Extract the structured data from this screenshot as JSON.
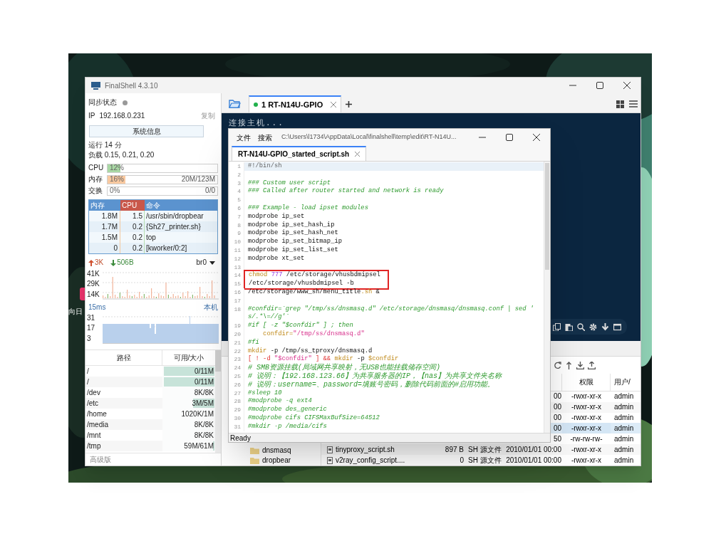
{
  "desktop": {
    "icon_label": "向日"
  },
  "window": {
    "title": "FinalShell 4.3.10"
  },
  "sidebar": {
    "sync_label": "同步状态",
    "ip_label": "IP",
    "ip": "192.168.0.231",
    "copy_link": "复制",
    "sysinfo_button": "系统信息",
    "uptime": "运行 14 分",
    "load": "负载 0.15, 0.21, 0.20",
    "meters": [
      {
        "label": "CPU",
        "percent": "12%",
        "level": 0.12,
        "color": "#a9d8a4"
      },
      {
        "label": "内存",
        "percent": "16%",
        "reading": "20M/123M",
        "level": 0.16,
        "color": "#f9c9a0"
      },
      {
        "label": "交换",
        "percent": "0%",
        "reading": "0/0"
      }
    ],
    "processes": {
      "columns": [
        {
          "label": "内存",
          "sorted": false
        },
        {
          "label": "CPU",
          "sorted": true
        },
        {
          "label": "命令",
          "sorted": false
        }
      ],
      "rows": [
        [
          "1.8M",
          "1.5",
          "/usr/sbin/dropbear"
        ],
        [
          "1.7M",
          "0.2",
          "{Sh27_printer.sh}"
        ],
        [
          "1.5M",
          "0.2",
          "top"
        ],
        [
          "0",
          "0.2",
          "[kworker/0:2]"
        ]
      ]
    },
    "network": {
      "up": "3K",
      "down": "506B",
      "interface": "br0",
      "y_labels": [
        "41K",
        "29K",
        "14K"
      ]
    },
    "ping": {
      "latency": "15ms",
      "host": "本机",
      "y_labels": [
        "31",
        "17",
        "3"
      ]
    },
    "disks": {
      "columns": [
        "路径",
        "可用/大小"
      ],
      "rows": [
        {
          "path": "/",
          "space": "0/11M",
          "level": 1
        },
        {
          "path": "/",
          "space": "0/11M",
          "level": 1
        },
        {
          "path": "/dev",
          "space": "8K/8K",
          "level": 0
        },
        {
          "path": "/etc",
          "space": "3M/5M",
          "level": 0.42
        },
        {
          "path": "/home",
          "space": "1020K/1M",
          "level": 0
        },
        {
          "path": "/media",
          "space": "8K/8K",
          "level": 0
        },
        {
          "path": "/mnt",
          "space": "8K/8K",
          "level": 0
        },
        {
          "path": "/tmp",
          "space": "59M/61M",
          "level": 0.03
        }
      ]
    },
    "footer": "高级版"
  },
  "session_tabs": [
    {
      "label": "1 RT-N14U-GPIO",
      "selected": true,
      "connected": true
    }
  ],
  "terminal": {
    "lines": [
      "连接主机..."
    ]
  },
  "file_tree": [
    {
      "name": "dnsmasq"
    },
    {
      "name": "dropbear"
    }
  ],
  "file_table": {
    "columns": [
      "权限",
      "用户/"
    ],
    "rows": [
      {
        "date": "00",
        "permissions": "-rwxr-xr-x",
        "owner": "admin",
        "selected": false
      },
      {
        "date": "00",
        "permissions": "-rwxr-xr-x",
        "owner": "admin",
        "selected": false
      },
      {
        "date": "00",
        "permissions": "-rwxr-xr-x",
        "owner": "admin",
        "selected": false
      },
      {
        "date": "00",
        "permissions": "-rwxr-xr-x",
        "owner": "admin",
        "selected": true
      },
      {
        "date": "50",
        "permissions": "-rw-rw-rw-",
        "owner": "admin",
        "selected": false
      },
      {
        "name": "tinyproxy_script.sh",
        "size": "897 B",
        "type": "SH 源文件",
        "date": "2010/01/01 00:00",
        "permissions": "-rwxr-xr-x",
        "owner": "admin",
        "selected": false
      },
      {
        "name": "v2ray_config_script....",
        "size": "0",
        "type": "SH 源文件",
        "date": "2010/01/01 00:00",
        "permissions": "-rwxr-xr-x",
        "owner": "admin",
        "selected": false
      }
    ]
  },
  "editor": {
    "menu": [
      "文件",
      "搜索"
    ],
    "path": "C:\\Users\\l1734\\AppData\\Local\\finalshell\\temp\\edit\\RT-N14U...",
    "tabs": [
      {
        "label": "RT-N14U-GPIO_started_script.sh",
        "selected": true
      }
    ],
    "lines": [
      {
        "num": "1",
        "current": true,
        "boxed": false,
        "segments": [
          {
            "kind": "shebang",
            "text": "#!/bin/sh"
          }
        ]
      },
      {
        "num": "2",
        "current": false,
        "boxed": false
      },
      {
        "num": "3",
        "current": false,
        "boxed": false,
        "segments": [
          {
            "kind": "comment",
            "text": "### Custom user script"
          }
        ]
      },
      {
        "num": "4",
        "current": false,
        "boxed": false,
        "segments": [
          {
            "kind": "comment",
            "text": "### Called after router started and network is ready"
          }
        ]
      },
      {
        "num": "5",
        "current": false,
        "boxed": false
      },
      {
        "num": "6",
        "current": false,
        "boxed": false,
        "segments": [
          {
            "kind": "comment",
            "text": "### Example - load ipset modules"
          }
        ]
      },
      {
        "num": "7",
        "current": false,
        "boxed": false,
        "segments": [
          {
            "kind": "plain",
            "text": "modprobe ip_set"
          }
        ]
      },
      {
        "num": "8",
        "current": false,
        "boxed": false,
        "segments": [
          {
            "kind": "plain",
            "text": "modprobe ip_set_hash_ip"
          }
        ]
      },
      {
        "num": "9",
        "current": false,
        "boxed": false,
        "segments": [
          {
            "kind": "plain",
            "text": "modprobe ip_set_hash_net"
          }
        ]
      },
      {
        "num": "10",
        "current": false,
        "boxed": false,
        "segments": [
          {
            "kind": "plain",
            "text": "modprobe ip_set_bitmap_ip"
          }
        ]
      },
      {
        "num": "11",
        "current": false,
        "boxed": false,
        "segments": [
          {
            "kind": "plain",
            "text": "modprobe ip_set_list_set"
          }
        ]
      },
      {
        "num": "12",
        "current": false,
        "boxed": false,
        "segments": [
          {
            "kind": "plain",
            "text": "modprobe xt_set"
          }
        ]
      },
      {
        "num": "13",
        "current": false,
        "boxed": false
      },
      {
        "num": "14",
        "current": false,
        "boxed": true,
        "segments": [
          {
            "kind": "keyword",
            "text": "chmod"
          },
          {
            "kind": "number",
            "text": " 777"
          },
          {
            "kind": "plain",
            "text": " /etc/storage/vhusbdmipsel"
          }
        ]
      },
      {
        "num": "15",
        "current": false,
        "boxed": true,
        "segments": [
          {
            "kind": "plain",
            "text": "/etc/storage/vhusbdmipsel -b"
          }
        ]
      },
      {
        "num": "16",
        "current": false,
        "boxed": false,
        "segments": [
          {
            "kind": "plain",
            "text": "/etc/storage/www_sh/menu_title"
          },
          {
            "kind": "keyword",
            "text": ".sh"
          },
          {
            "kind": "plain",
            "text": " &"
          }
        ]
      },
      {
        "num": "17",
        "current": false,
        "boxed": false
      },
      {
        "num": "18",
        "current": false,
        "boxed": false,
        "segments": [
          {
            "kind": "comment",
            "text": "#confdir=`grep \"/tmp/ss/dnsmasq.d\" /etc/storage/dnsmasq/dnsmasq.conf | sed '"
          }
        ],
        "wrap": [
          {
            "kind": "comment",
            "text": "s/.*\\=//g'`"
          }
        ]
      },
      {
        "num": "19",
        "current": false,
        "boxed": false,
        "segments": [
          {
            "kind": "comment",
            "text": "#if [ -z \"$confdir\" ] ; then"
          }
        ]
      },
      {
        "num": "20",
        "current": false,
        "boxed": false,
        "segments": [
          {
            "kind": "keyword",
            "text": "    confdir="
          },
          {
            "kind": "string",
            "text": "\"/tmp/ss/dnsmasq.d\""
          }
        ]
      },
      {
        "num": "21",
        "current": false,
        "boxed": false,
        "segments": [
          {
            "kind": "comment",
            "text": "#fi"
          }
        ]
      },
      {
        "num": "22",
        "current": false,
        "boxed": false,
        "segments": [
          {
            "kind": "keyword",
            "text": "mkdir"
          },
          {
            "kind": "plain",
            "text": " -p /tmp/ss_tproxy/dnsmasq.d"
          }
        ]
      },
      {
        "num": "23",
        "current": false,
        "boxed": false,
        "segments": [
          {
            "kind": "error",
            "text": "[ ! -d "
          },
          {
            "kind": "string",
            "text": "\"$confdir\""
          },
          {
            "kind": "error",
            "text": " ] && "
          },
          {
            "kind": "keyword",
            "text": "mkdir"
          },
          {
            "kind": "plain",
            "text": " -p "
          },
          {
            "kind": "keyword",
            "text": "$confdir"
          }
        ]
      },
      {
        "num": "24",
        "current": false,
        "boxed": false,
        "segments": [
          {
            "kind": "comment",
            "text": "# SMB资源挂载(局域网共享映射，无USB也能挂载储存空间)"
          }
        ]
      },
      {
        "num": "25",
        "current": false,
        "boxed": false,
        "segments": [
          {
            "kind": "comment",
            "text": "# 说明：【192.168.123.66】为共享服务器的IP，【nas】为共享文件夹名称"
          }
        ]
      },
      {
        "num": "26",
        "current": false,
        "boxed": false,
        "segments": [
          {
            "kind": "comment",
            "text": "# 说明：username=、password=填账号密码，删除代码前面的#启用功能。"
          }
        ]
      },
      {
        "num": "27",
        "current": false,
        "boxed": false,
        "segments": [
          {
            "kind": "comment",
            "text": "#sleep 10"
          }
        ]
      },
      {
        "num": "28",
        "current": false,
        "boxed": false,
        "segments": [
          {
            "kind": "comment",
            "text": "#modprobe -q ext4"
          }
        ]
      },
      {
        "num": "29",
        "current": false,
        "boxed": false,
        "segments": [
          {
            "kind": "comment",
            "text": "#modprobe des_generic"
          }
        ]
      },
      {
        "num": "30",
        "current": false,
        "boxed": false,
        "segments": [
          {
            "kind": "comment",
            "text": "#modprobe cifs CIFSMaxBufSize=64512"
          }
        ]
      },
      {
        "num": "31",
        "current": false,
        "boxed": false,
        "segments": [
          {
            "kind": "comment",
            "text": "#mkdir -p /media/cifs"
          }
        ]
      }
    ],
    "status": "Ready"
  }
}
